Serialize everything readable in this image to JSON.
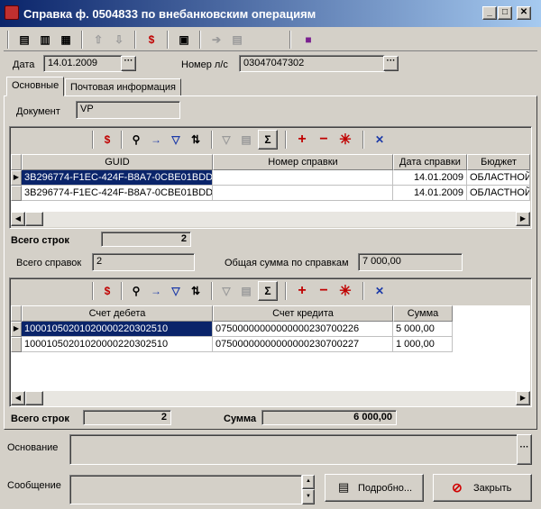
{
  "window": {
    "title": "Справка ф. 0504833 по внебанковским операциям",
    "minimize_glyph": "_",
    "maximize_glyph": "□",
    "close_glyph": "✕"
  },
  "header": {
    "date_label": "Дата",
    "date_value": "14.01.2009",
    "account_label": "Номер л/с",
    "account_value": "03047047302"
  },
  "tabs": [
    {
      "label": "Основные"
    },
    {
      "label": "Почтовая информация"
    }
  ],
  "document": {
    "label": "Документ",
    "value": "VP"
  },
  "grid1": {
    "columns": [
      "GUID",
      "Номер справки",
      "Дата справки",
      "Бюджет"
    ],
    "rows": [
      {
        "guid": "3B296774-F1EC-424F-B8A7-0CBE01BDD",
        "number": "",
        "date": "14.01.2009",
        "budget": "ОБЛАСТНОЙ Б"
      },
      {
        "guid": "3B296774-F1EC-424F-B8A7-0CBE01BDD",
        "number": "",
        "date": "14.01.2009",
        "budget": "ОБЛАСТНОЙ Б"
      }
    ],
    "total_label": "Всего строк",
    "total_value": "2"
  },
  "summary": {
    "count_label": "Всего справок",
    "count_value": "2",
    "sum_label": "Общая сумма по справкам",
    "sum_value": "7 000,00"
  },
  "grid2": {
    "columns": [
      "Счет дебета",
      "Счет кредита",
      "Сумма"
    ],
    "rows": [
      {
        "debit": "10001050201020000220302510",
        "credit": "07500000000000000230700226",
        "amount": "5 000,00"
      },
      {
        "debit": "10001050201020000220302510",
        "credit": "07500000000000000230700227",
        "amount": "1 000,00"
      }
    ],
    "total_label": "Всего строк",
    "total_value": "2",
    "sum_label": "Сумма",
    "sum_value": "6 000,00"
  },
  "basis": {
    "label": "Основание",
    "value": ""
  },
  "message": {
    "label": "Сообщение",
    "value": ""
  },
  "buttons": {
    "details": "Подробно...",
    "close": "Закрыть"
  },
  "icons": {
    "toolbar": [
      "print-icon",
      "preview-icon",
      "print-setup-icon",
      "export-icon",
      "import-icon",
      "dollar-icon",
      "report-icon",
      "send-icon",
      "receive-icon",
      "book-icon"
    ],
    "grid_toolbar": [
      "dollar-icon",
      "find-icon",
      "find-next-icon",
      "filter-icon",
      "sort-icon",
      "filter-clear-icon",
      "copy-icon",
      "sum-icon",
      "add-icon",
      "remove-icon",
      "asterisk-icon",
      "settings-icon"
    ]
  }
}
